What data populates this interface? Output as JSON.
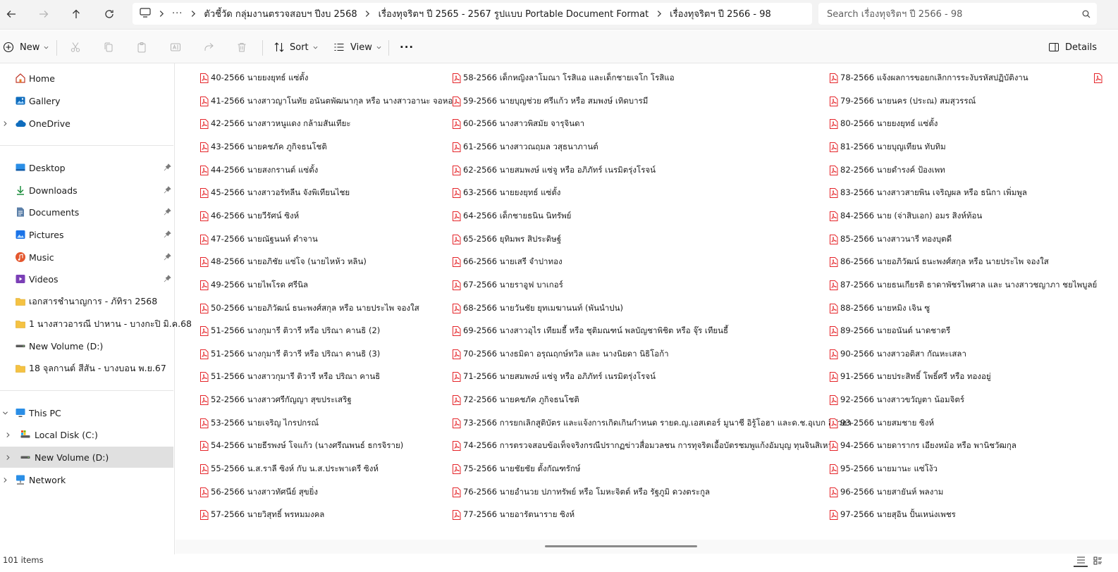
{
  "address": {
    "crumbs": [
      "ตัวชี้วัด กลุ่มงานตรวจสอบฯ ปีงบ 2568",
      "เรื่องทุจริตฯ ปี 2565 - 2567 รูปแบบ Portable Document Format",
      "เรื่องทุจริตฯ ปี 2566 - 98"
    ],
    "overflow": "···"
  },
  "search": {
    "placeholder": "Search เรื่องทุจริตฯ ปี 2566 - 98"
  },
  "toolbar": {
    "new_label": "New",
    "sort_label": "Sort",
    "view_label": "View",
    "more_label": "···",
    "details_label": "Details"
  },
  "sidebar": {
    "items": [
      {
        "label": "Home",
        "icon": "home-icon"
      },
      {
        "label": "Gallery",
        "icon": "gallery-icon"
      },
      {
        "label": "OneDrive",
        "icon": "cloud-icon"
      },
      {
        "label": "Desktop",
        "icon": "desktop-icon"
      },
      {
        "label": "Downloads",
        "icon": "download-icon"
      },
      {
        "label": "Documents",
        "icon": "documents-icon"
      },
      {
        "label": "Pictures",
        "icon": "pictures-icon"
      },
      {
        "label": "Music",
        "icon": "music-icon"
      },
      {
        "label": "Videos",
        "icon": "videos-icon"
      },
      {
        "label": "เอกสารชำนาญการ - ภัทิรา 2568",
        "icon": "folder-icon"
      },
      {
        "label": "1 นางสาวอารณี ปาหาน - บางกะปิ มิ.ค.68",
        "icon": "folder-icon"
      },
      {
        "label": "New Volume (D:)",
        "icon": "drive-icon"
      },
      {
        "label": "18 จุลกานต์ สีสัน - บางบอน พ.ย.67",
        "icon": "folder-icon"
      },
      {
        "label": "This PC",
        "icon": "pc-icon"
      },
      {
        "label": "Local Disk (C:)",
        "icon": "local-disk-icon"
      },
      {
        "label": "New Volume (D:)",
        "icon": "drive-icon"
      },
      {
        "label": "Network",
        "icon": "network-icon"
      }
    ]
  },
  "files": {
    "col1": [
      "40-2566 นายยงยุทธ์ แซ่ตั้ง",
      "41-2566 นางสาวญาโนทัย อนันตพัฒนากุล หรือ นางสาวอานะ จอหอ",
      "42-2566 นางสาวหนูแดง กล้ามสันเทียะ",
      "43-2566 นายคชภัค ภูกิจธนโชติ",
      "44-2566 นายสงกรานต์ แซ่ตั้ง",
      "45-2566 นางสาวอรัทลีน จังพิเทียนไชย",
      "46-2566 นายวีรัศน์ ซิงห์",
      "47-2566 นายณัฐนนท์ ตำจาน",
      "48-2566 นายอภิชัย แซ่โจ (นายไหห้ว หลิน)",
      "49-2566 นายไพโรด ศรีนิล",
      "50-2566 นายอภิวัฒน์ ธนะพงศ์สกุล หรือ นายประไพ จองใส",
      "51-2566 นางกุมารี ติวารี หรือ ปริณา คานธิ (2)",
      "51-2566 นางกุมารี ติวารี หรือ ปริณา คานธิ (3)",
      "51-2566 นางสาวกุมารี ติวารี หรือ ปริณา คานธิ",
      "52-2566 นางสาวศรีกัญญา สุขประเสริฐ",
      "53-2566 นายเจริญ ไกรปกรณ์",
      "54-2566 นายธีรพงษ์ โจแก้ว (นางศรีณพนธ์ ธกรจิราย)",
      "55-2566 น.ส.ราลี ซิงห์ กับ น.ส.ประพาเดรี ซิงห์",
      "56-2566 นางสาวทัศนีย์ สุขยิ่ง",
      "57-2566 นายวิสุทธิ์ พรหมมงคล"
    ],
    "col2": [
      "58-2566 เด็กหญิงลาโมณา โรสิแอ และเด็กชายเจโก โรสิแอ",
      "59-2566 นายบุญช่วย ศรีแก้ว หรือ สมพงษ์ เทิดบารมี",
      "60-2566 นางสาวพิสมัย จารุจินดา",
      "61-2566 นางสาวณฤมล วสุธนาภานต์",
      "62-2566 นายสมพงษ์ แซ่จู หรือ อภิภัทร์ เนรมิตรุ่งโรจน์",
      "63-2566 นายยงยุทธ์ แซ่ตั้ง",
      "64-2566 เด็กชายธนิน นิทรัพย์",
      "65-2566 ยุทิมพร สิประดิษฐ์",
      "66-2566 นายเสรี จำปาทอง",
      "67-2566 นายราอูฟ บาเกอร์",
      "68-2566 นายวันชัย ยุทเมฆานนท์ (พันนำปน)",
      "69-2566 นางสาวอุไร เทียมธี้ หรือ ชุติมณฑน์ พลบัญชาพิชิต หรือ จุ๊ร เทียนธี้",
      "70-2566 นางธมิดา อรุณฤกษ์ทวิล และ นางนิยดา นิธิโอก้า",
      "71-2566 นายสมพงษ์ แซ่จู หรือ อภิภัทร์ เนรมิตรุ่งโรจน์",
      "72-2566 นายคชภัค ภูกิจธนโชติ",
      "73-2566 การยกเลิกสูติบัตร และแจ้งการเกิดเกินกำหนด รายด.ญ.เอสเตอร์ มูนาชี อิรู้โอฮา และด.ช.อุเบก อิวัวฮา",
      "74-2566 การตรวจสอบข้อเท็จจริงกรณีปรากฏข่าวสื่อมวลชน การทุจริตเอื้อบัตรชมพูแก้งอัมบุญ ทุนจินสิเหา",
      "75-2566 นายชัยชัย ตั้งกัณฑรักษ์",
      "76-2566 นายอำนวย ปภาทรัพย์ หรือ โมหะจิตต์ หรือ รัฐภูมิ ดวงตระกูล",
      "77-2566 นายอารัตนาราย ซิงห์"
    ],
    "col3": [
      "78-2566 แจ้งผลการขอยกเลิกการระงับรหัสปฏิบัติงาน",
      "79-2566 นายนคร (ประณ) สมสุวรรณ์",
      "80-2566 นายยงยุทธ์ แซ่ตั้ง",
      "81-2566 นายบุญเทียน ทับทิม",
      "82-2566 นายดำรงค์ ป้องเพท",
      "83-2566 นางสาวสายพิน เจริญผล หรือ ธนิกา เพิ่มพูล",
      "84-2566 นาย (จ่าสิบเอก) อมร สิงห์ท้อน",
      "85-2566 นางสาวนารี ทองบุตดี",
      "86-2566 นายอภิวัฒน์ ธนะพงศ์สกุล หรือ นายประไพ จองใส",
      "87-2566 นายธนเกียรติ ธาดาพัชรไพศาล และ นางสาวชญาภา ชยไพบูลย์",
      "88-2566 นายหมิง เจิน ซู",
      "89-2566 นายอนันต์ นาดชาตรี",
      "90-2566 นางสาวอติสา กัณหะเสลา",
      "91-2566 นายประสิทธิ์ โพธิ์ศรี หรือ ทองอยู่",
      "92-2566 นางสาวขวัญตา น้อมจิตร์",
      "93-2566 นายสมชาย ซิงห์",
      "94-2566 นายดารากร เอียงหม้อ หรือ พานิชวัฒกุล",
      "95-2566 นายมานะ แซ่โง้ว",
      "96-2566 นายสายันห์ พลงาม",
      "97-2566 นายสุอิน ปั้นเหน่งเพชร"
    ]
  },
  "status": {
    "count": "101 items"
  },
  "colors": {
    "pdf_red": "#e5252a",
    "onedrive_blue": "#0f6cbd",
    "folder_yellow": "#f5c242",
    "selected_bg": "#e0e0e0"
  }
}
